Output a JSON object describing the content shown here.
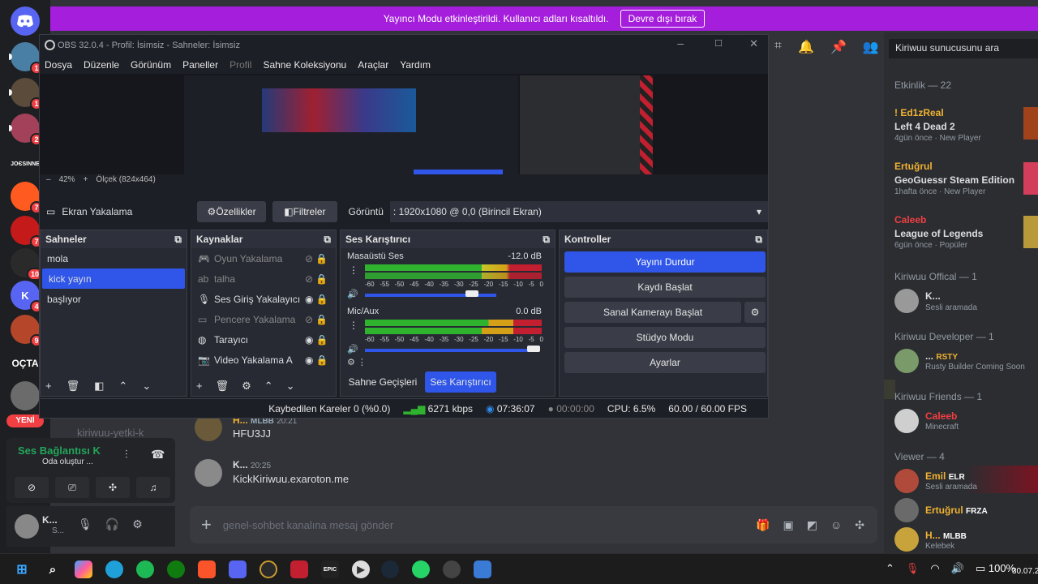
{
  "banner": {
    "text": "Yayıncı Modu etkinleştirildi. Kullanıcı adları kısaltıldı.",
    "button": "Devre dışı bırak"
  },
  "rail": {
    "servers": [
      {
        "badge": "1"
      },
      {
        "badge": "1"
      },
      {
        "badge": "2"
      },
      {
        "text": "ЈОЄSІNNE"
      },
      {
        "badge": "7"
      },
      {
        "badge": "7"
      },
      {
        "badge": "10"
      },
      {
        "text": "K",
        "badge": "4"
      },
      {
        "badge": "9"
      },
      {
        "text": "OÇTA"
      },
      {
        "text": "YENİ"
      }
    ]
  },
  "obs": {
    "title": "OBS 32.0.4 - Profil: İsimsiz - Sahneler: İsimsiz",
    "menu": [
      "Dosya",
      "Düzenle",
      "Görünüm",
      "Paneller",
      "Profil",
      "Sahne Koleksiyonu",
      "Araçlar",
      "Yardım"
    ],
    "zoom": "42%",
    "scale": "Ölçek (824x464)",
    "source_bar": {
      "name": "Ekran Yakalama",
      "props": "Özellikler",
      "filters": "Filtreler",
      "display_label": "Görüntü",
      "display_value": ": 1920x1080 @ 0,0 (Birincil Ekran)"
    },
    "scenes": {
      "title": "Sahneler",
      "items": [
        "mola",
        "kick yayın",
        "başlıyor"
      ]
    },
    "sources": {
      "title": "Kaynaklar",
      "items": [
        "Oyun Yakalama",
        "talha",
        "Ses Giriş Yakalayıcı",
        "Pencere Yakalama",
        "Tarayıcı",
        "Video Yakalama A"
      ]
    },
    "mixer": {
      "title": "Ses Karıştırıcı",
      "channels": [
        {
          "name": "Masaüstü Ses",
          "db": "-12.0 dB"
        },
        {
          "name": "Mic/Aux",
          "db": "0.0 dB"
        }
      ],
      "ticks": [
        "-60",
        "-55",
        "-50",
        "-45",
        "-40",
        "-35",
        "-30",
        "-25",
        "-20",
        "-15",
        "-10",
        "-5",
        "0"
      ],
      "tab_transitions": "Sahne Geçişleri",
      "tab_mixer": "Ses Karıştırıcı"
    },
    "controls": {
      "title": "Kontroller",
      "stop": "Yayını Durdur",
      "record": "Kaydı Başlat",
      "vcam": "Sanal Kamerayı Başlat",
      "studio": "Stüdyo Modu",
      "settings": "Ayarlar"
    },
    "status": {
      "dropped": "Kaybedilen Kareler 0 (%0.0)",
      "bitrate": "6271 kbps",
      "stream_time": "07:36:07",
      "rec_time": "00:00:00",
      "cpu": "CPU: 6.5%",
      "fps": "60.00 / 60.00 FPS"
    }
  },
  "members": {
    "search": "Kiriwuu sunucusunu ara",
    "activity_head": "Etkinlik — 22",
    "activity": [
      {
        "name": "! Ed1zReal",
        "game": "Left 4 Dead 2",
        "meta1": "4gün önce",
        "meta2": "New Player"
      },
      {
        "name": "Ertuğrul",
        "game": "GeoGuessr Steam Edition",
        "meta1": "1hafta önce",
        "meta2": "New Player"
      },
      {
        "name": "Caleeb",
        "game": "League of Legends",
        "meta1": "6gün önce",
        "meta2": "Popüler"
      }
    ],
    "groups": [
      {
        "head": "Kiriwuu Offical — 1",
        "name": "K...",
        "sub": "Sesli aramada",
        "tag": ""
      },
      {
        "head": "Kiriwuu Developer — 1",
        "name": "...",
        "sub": "Rusty Builder Coming Soon",
        "tag": "RSTY"
      },
      {
        "head": "Kiriwuu Friends — 1",
        "name": "Caleeb",
        "sub": "Minecraft",
        "tag": ""
      },
      {
        "head": "Viewer — 4",
        "name": "Emil",
        "sub": "Sesli aramada",
        "tag": "ELR"
      }
    ],
    "more": [
      {
        "name": "Ertuğrul",
        "tag": "FRZA",
        "sub": ""
      },
      {
        "name": "H...",
        "tag": "MLBB",
        "sub": "Kelebek"
      }
    ]
  },
  "chat": {
    "messages": [
      {
        "name": "H...",
        "tag": "MLBB",
        "time": "20:21",
        "text": "HFU3JJ"
      },
      {
        "name": "K...",
        "time": "20:25",
        "text": "KickKiriwuu.exaroton.me"
      }
    ],
    "channel_peek": "kiriwuu-yetki-k",
    "placeholder": "genel-sohbet kanalına mesaj gönder"
  },
  "voice": {
    "title": "Ses Bağlantısı K",
    "sub": "Oda oluştur ..."
  },
  "user": {
    "name": "K...",
    "status": "S..."
  },
  "taskbar": {
    "battery": "100%",
    "date": "30.07.2"
  }
}
